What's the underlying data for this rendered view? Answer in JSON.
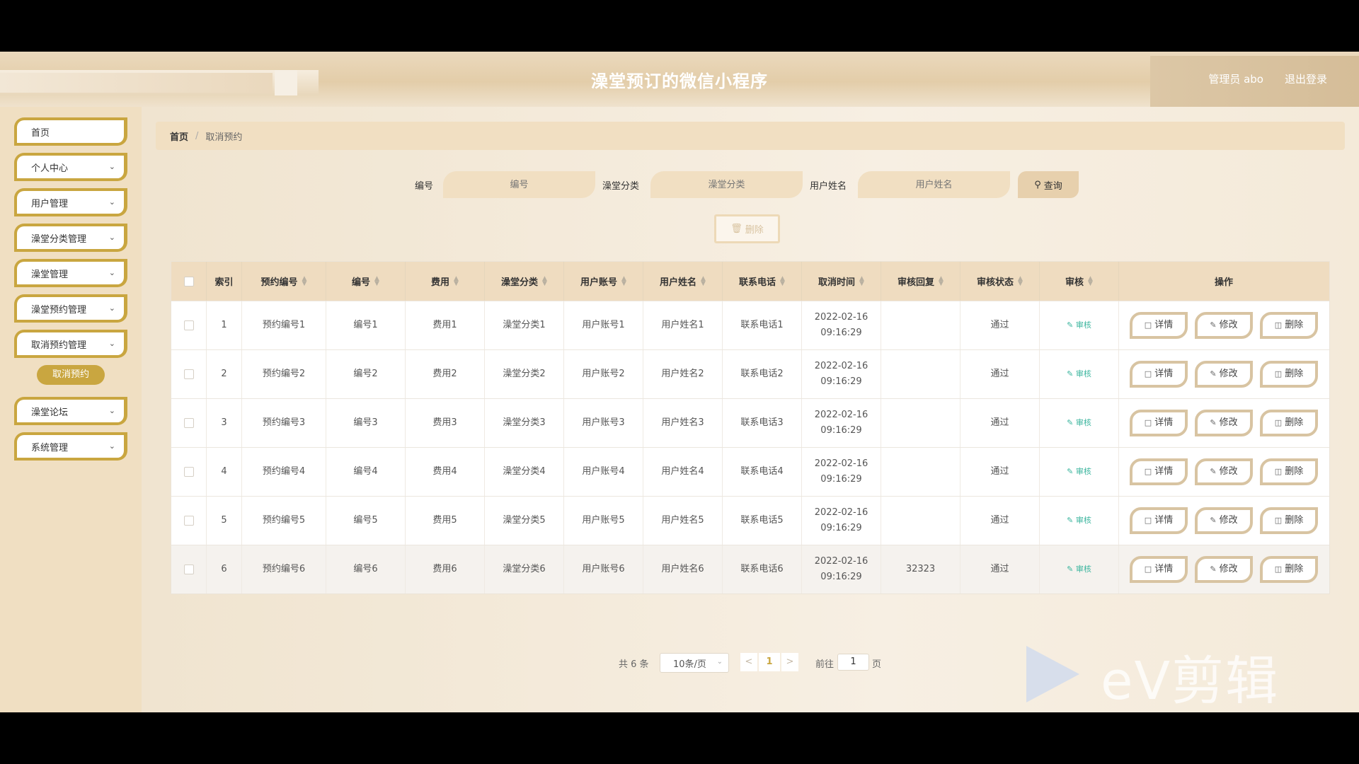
{
  "header": {
    "title": "澡堂预订的微信小程序",
    "user": "管理员 abo",
    "logout": "退出登录"
  },
  "sidebar": {
    "items": [
      {
        "label": "首页",
        "chevron": false
      },
      {
        "label": "个人中心",
        "chevron": true
      },
      {
        "label": "用户管理",
        "chevron": true
      },
      {
        "label": "澡堂分类管理",
        "chevron": true
      },
      {
        "label": "澡堂管理",
        "chevron": true
      },
      {
        "label": "澡堂预约管理",
        "chevron": true
      },
      {
        "label": "取消预约管理",
        "chevron": true
      },
      {
        "label": "澡堂论坛",
        "chevron": true
      },
      {
        "label": "系统管理",
        "chevron": true
      }
    ],
    "active_sub": "取消预约"
  },
  "breadcrumb": {
    "home": "首页",
    "sep": "/",
    "current": "取消预约"
  },
  "search": {
    "field1_label": "编号",
    "field1_placeholder": "编号",
    "field2_label": "澡堂分类",
    "field2_placeholder": "澡堂分类",
    "field3_label": "用户姓名",
    "field3_placeholder": "用户姓名",
    "query_label": "查询"
  },
  "delete_label": "删除",
  "table": {
    "headers": [
      "索引",
      "预约编号",
      "编号",
      "费用",
      "澡堂分类",
      "用户账号",
      "用户姓名",
      "联系电话",
      "取消时间",
      "审核回复",
      "审核状态",
      "审核",
      "操作"
    ],
    "rows": [
      {
        "idx": "1",
        "order": "预约编号1",
        "no": "编号1",
        "fee": "费用1",
        "cat": "澡堂分类1",
        "acct": "用户账号1",
        "name": "用户姓名1",
        "phone": "联系电话1",
        "time": "2022-02-16 09:16:29",
        "reply": "",
        "status": "通过"
      },
      {
        "idx": "2",
        "order": "预约编号2",
        "no": "编号2",
        "fee": "费用2",
        "cat": "澡堂分类2",
        "acct": "用户账号2",
        "name": "用户姓名2",
        "phone": "联系电话2",
        "time": "2022-02-16 09:16:29",
        "reply": "",
        "status": "通过"
      },
      {
        "idx": "3",
        "order": "预约编号3",
        "no": "编号3",
        "fee": "费用3",
        "cat": "澡堂分类3",
        "acct": "用户账号3",
        "name": "用户姓名3",
        "phone": "联系电话3",
        "time": "2022-02-16 09:16:29",
        "reply": "",
        "status": "通过"
      },
      {
        "idx": "4",
        "order": "预约编号4",
        "no": "编号4",
        "fee": "费用4",
        "cat": "澡堂分类4",
        "acct": "用户账号4",
        "name": "用户姓名4",
        "phone": "联系电话4",
        "time": "2022-02-16 09:16:29",
        "reply": "",
        "status": "通过"
      },
      {
        "idx": "5",
        "order": "预约编号5",
        "no": "编号5",
        "fee": "费用5",
        "cat": "澡堂分类5",
        "acct": "用户账号5",
        "name": "用户姓名5",
        "phone": "联系电话5",
        "time": "2022-02-16 09:16:29",
        "reply": "",
        "status": "通过"
      },
      {
        "idx": "6",
        "order": "预约编号6",
        "no": "编号6",
        "fee": "费用6",
        "cat": "澡堂分类6",
        "acct": "用户账号6",
        "name": "用户姓名6",
        "phone": "联系电话6",
        "time": "2022-02-16 09:16:29",
        "reply": "32323",
        "status": "通过"
      }
    ],
    "audit_label": "审核",
    "detail_label": "详情",
    "edit_label": "修改",
    "del_label": "删除"
  },
  "pager": {
    "total": "共 6 条",
    "size": "10条/页",
    "prev": "<",
    "page": "1",
    "next": ">",
    "goto": "前往",
    "goto_value": "1",
    "page_suffix": "页"
  },
  "watermark": "eV剪辑",
  "colors": {
    "accent": "#c9a640",
    "header_bg": "#e3cda9",
    "audit": "#3bb59e"
  }
}
